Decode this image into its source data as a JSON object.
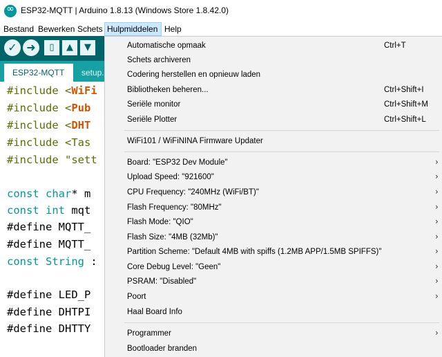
{
  "window": {
    "title": "ESP32-MQTT | Arduino 1.8.13 (Windows Store 1.8.42.0)"
  },
  "menubar": [
    "Bestand",
    "Bewerken",
    "Schets",
    "Hulpmiddelen",
    "Help"
  ],
  "toolbar": {
    "verify": "✓",
    "upload": "➜",
    "new": "▯",
    "open": "▲",
    "save": "▼"
  },
  "tabs": [
    "ESP32-MQTT",
    "setup."
  ],
  "code": [
    {
      "parts": [
        "#include <",
        "WiFi"
      ]
    },
    {
      "parts": [
        "#include <",
        "Pub"
      ]
    },
    {
      "parts": [
        "#include <",
        "DHT"
      ]
    },
    {
      "parts": [
        "#include <Tas"
      ]
    },
    {
      "parts": [
        "#include \"sett"
      ]
    },
    {
      "parts": [
        "const",
        " ",
        "char",
        "* m"
      ]
    },
    {
      "parts": [
        "const",
        " ",
        "int",
        " mqt"
      ]
    },
    {
      "parts": [
        "#define MQTT_"
      ]
    },
    {
      "parts": [
        "#define MQTT_"
      ]
    },
    {
      "parts": [
        "const",
        " ",
        "String",
        " :"
      ]
    },
    {
      "parts": [
        "#define LED_P"
      ]
    },
    {
      "parts": [
        "#define DHTPI"
      ]
    },
    {
      "parts": [
        "#define DHTTY"
      ]
    }
  ],
  "menu": {
    "items": [
      {
        "label": "Automatische opmaak",
        "shortcut": "Ctrl+T"
      },
      {
        "label": "Schets archiveren",
        "shortcut": ""
      },
      {
        "label": "Codering herstellen en opnieuw laden",
        "shortcut": ""
      },
      {
        "label": "Bibliotheken beheren...",
        "shortcut": "Ctrl+Shift+I"
      },
      {
        "label": "Seriële monitor",
        "shortcut": "Ctrl+Shift+M"
      },
      {
        "label": "Seriële Plotter",
        "shortcut": "Ctrl+Shift+L"
      },
      {
        "label": "WiFi101 / WiFiNINA Firmware Updater",
        "shortcut": ""
      },
      {
        "label": "Board: \"ESP32 Dev Module\"",
        "arrow": "›"
      },
      {
        "label": "Upload Speed: \"921600\"",
        "arrow": "›"
      },
      {
        "label": "CPU Frequency: \"240MHz (WiFi/BT)\"",
        "arrow": "›"
      },
      {
        "label": "Flash Frequency: \"80MHz\"",
        "arrow": "›"
      },
      {
        "label": "Flash Mode: \"QIO\"",
        "arrow": "›"
      },
      {
        "label": "Flash Size: \"4MB (32Mb)\"",
        "arrow": "›"
      },
      {
        "label": "Partition Scheme: \"Default 4MB with spiffs (1.2MB APP/1.5MB SPIFFS)\"",
        "arrow": "›"
      },
      {
        "label": "Core Debug Level: \"Geen\"",
        "arrow": "›"
      },
      {
        "label": "PSRAM: \"Disabled\"",
        "arrow": "›"
      },
      {
        "label": "Poort",
        "arrow": "›"
      },
      {
        "label": "Haal Board Info",
        "arrow": ""
      },
      {
        "label": "Programmer",
        "arrow": "›"
      },
      {
        "label": "Bootloader branden",
        "arrow": ""
      }
    ]
  }
}
